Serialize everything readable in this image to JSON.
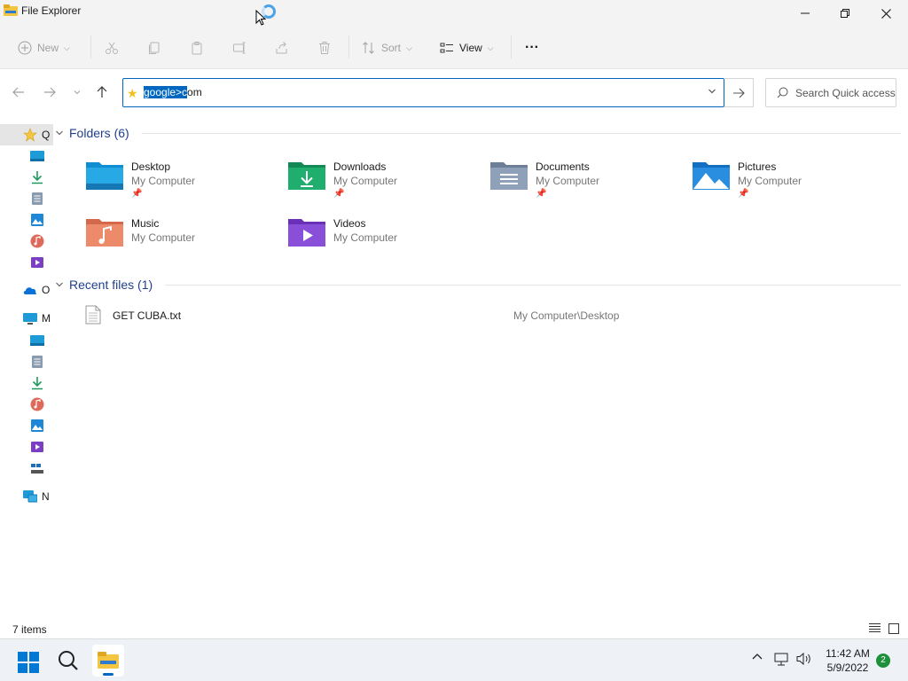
{
  "window": {
    "title": "File Explorer"
  },
  "toolbar": {
    "new_label": "New",
    "sort_label": "Sort",
    "view_label": "View",
    "more_label": "···"
  },
  "address": {
    "selected_text": "google>c",
    "rest_text": "om"
  },
  "search": {
    "placeholder": "Search Quick access"
  },
  "sidebar": {
    "items": [
      {
        "label": "Q",
        "icon": "star-icon"
      },
      {
        "label": "",
        "icon": "desktop-icon"
      },
      {
        "label": "",
        "icon": "downloads-icon"
      },
      {
        "label": "",
        "icon": "documents-icon"
      },
      {
        "label": "",
        "icon": "pictures-icon"
      },
      {
        "label": "",
        "icon": "music-icon"
      },
      {
        "label": "",
        "icon": "videos-icon"
      },
      {
        "label": "O",
        "icon": "onedrive-icon"
      },
      {
        "label": "M",
        "icon": "computer-icon"
      },
      {
        "label": "",
        "icon": "desktop-icon"
      },
      {
        "label": "",
        "icon": "documents-icon"
      },
      {
        "label": "",
        "icon": "downloads-icon"
      },
      {
        "label": "",
        "icon": "music-icon"
      },
      {
        "label": "",
        "icon": "pictures-icon"
      },
      {
        "label": "",
        "icon": "videos-icon"
      },
      {
        "label": "",
        "icon": "drive-icon"
      },
      {
        "label": "N",
        "icon": "network-icon"
      }
    ]
  },
  "folders_group": {
    "title": "Folders (6)",
    "items": [
      {
        "name": "Desktop",
        "location": "My Computer",
        "pinned": true,
        "icon": "desktop-folder-icon"
      },
      {
        "name": "Downloads",
        "location": "My Computer",
        "pinned": true,
        "icon": "downloads-folder-icon"
      },
      {
        "name": "Documents",
        "location": "My Computer",
        "pinned": true,
        "icon": "documents-folder-icon"
      },
      {
        "name": "Pictures",
        "location": "My Computer",
        "pinned": true,
        "icon": "pictures-folder-icon"
      },
      {
        "name": "Music",
        "location": "My Computer",
        "pinned": false,
        "icon": "music-folder-icon"
      },
      {
        "name": "Videos",
        "location": "My Computer",
        "pinned": false,
        "icon": "videos-folder-icon"
      }
    ]
  },
  "recent_group": {
    "title": "Recent files (1)",
    "items": [
      {
        "name": "GET CUBA.txt",
        "path": "My Computer\\Desktop",
        "icon": "text-file-icon"
      }
    ]
  },
  "status": {
    "count": "7 items"
  },
  "taskbar": {
    "time": "11:42 AM",
    "date": "5/9/2022",
    "notifications": "2"
  },
  "colors": {
    "accent": "#0067c0",
    "group_header": "#1f3f8f",
    "badge": "#1e8f3a"
  }
}
